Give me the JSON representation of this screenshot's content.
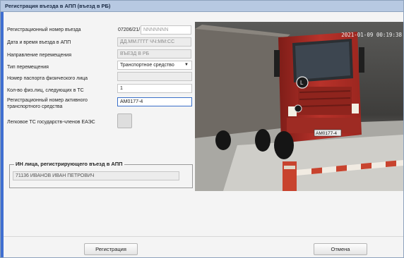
{
  "window": {
    "title": "Регистрация въезда в АПП (въезд в РБ)"
  },
  "form": {
    "reg_number": {
      "label": "Регистрационный номер въезда",
      "prefix": "07206/21/",
      "placeholder": "NNNNNNN"
    },
    "datetime": {
      "label": "Дата и время въезда в АПП",
      "placeholder": "ДД.ММ.ГГГГ ЧЧ:ММ:СС"
    },
    "direction": {
      "label": "Направление перемещения",
      "value": "ВЪЕЗД В РБ"
    },
    "move_type": {
      "label": "Тип перемещения",
      "value": "Транспортное средство"
    },
    "passport": {
      "label": "Номер паспорта физического лица",
      "value": ""
    },
    "persons": {
      "label": "Кол-во физ.лиц, следующих в ТС",
      "value": "1"
    },
    "vehicle_reg": {
      "label": "Регистрационный номер активного транспортного средства",
      "value": "AM0177-4"
    },
    "eaeu_vehicle": {
      "label": "Легковое ТС государств-членов ЕАЭС"
    }
  },
  "registrar": {
    "legend": "ИН лица, регистрирующего въезд в АПП",
    "value": "71136   ИВАНОВ ИВАН ПЕТРОВИЧ"
  },
  "camera": {
    "timestamp": "2021-01-09 00:19:38",
    "plate": "AM0177-4"
  },
  "buttons": {
    "register": "Регистрация",
    "cancel": "Отмена"
  },
  "colors": {
    "titlebar": "#b7c9e2",
    "accent": "#3f6fd1",
    "truck": "#b8322a",
    "barrier": "#c8432e"
  }
}
